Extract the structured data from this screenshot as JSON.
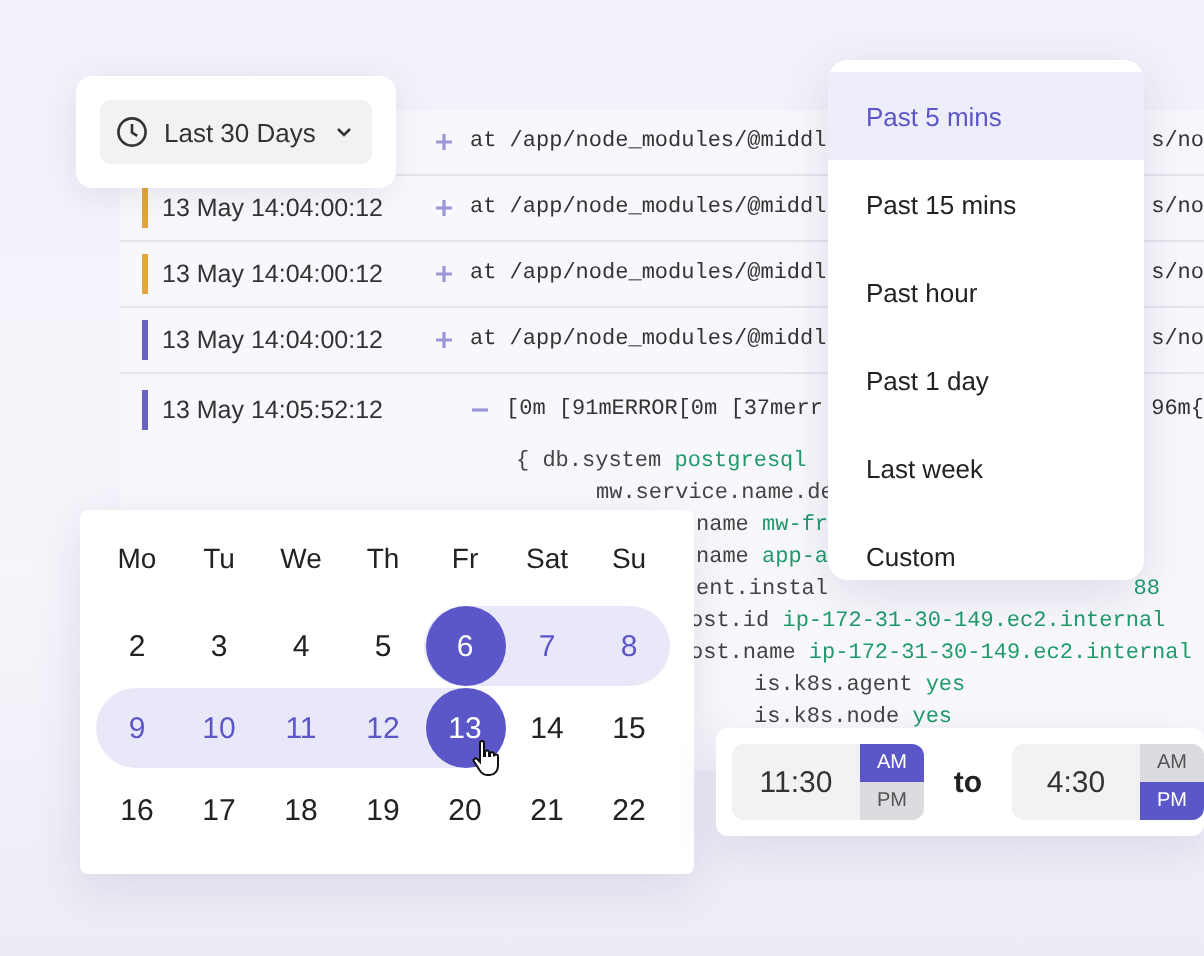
{
  "date_button": {
    "label": "Last 30 Days"
  },
  "log_rows": [
    {
      "expanded": false,
      "text": "at /app/node_modules/@middl",
      "tail": "s/no"
    },
    {
      "timestamp": "13 May 14:04:00:12",
      "color": "#e3a63a",
      "expanded": false,
      "text": "at /app/node_modules/@middl",
      "tail": "s/no"
    },
    {
      "timestamp": "13 May 14:04:00:12",
      "color": "#e3a63a",
      "expanded": false,
      "text": "at /app/node_modules/@middl",
      "tail": "s/no"
    },
    {
      "timestamp": "13 May 14:04:00:12",
      "color": "#6a62c2",
      "expanded": false,
      "text": "at /app/node_modules/@middl",
      "tail": "s/no"
    },
    {
      "timestamp": "13 May 14:05:52:12",
      "color": "#6a62c2",
      "expanded": true,
      "text": "[0m [91mERROR[0m [37merr",
      "tail": "96m{"
    }
  ],
  "code_lines": [
    {
      "key": "{ db.system",
      "value": "postgresql"
    },
    {
      "key": "mw.service.name.de"
    },
    {
      "key": "name",
      "value": "mw-fr"
    },
    {
      "key": "name",
      "value": "app-a"
    },
    {
      "key": "ent.instal",
      "tail": "88"
    },
    {
      "key": "ost.id",
      "value": "ip-172-31-30-149.ec2.internal"
    },
    {
      "key": "ost.name",
      "value": "ip-172-31-30-149.ec2.internal"
    },
    {
      "key": "is.k8s.agent",
      "value": "yes"
    },
    {
      "key": "is.k8s.node",
      "value": "yes"
    }
  ],
  "range_menu": [
    {
      "label": "Past 5 mins",
      "selected": true
    },
    {
      "label": "Past 15 mins",
      "selected": false
    },
    {
      "label": "Past hour",
      "selected": false
    },
    {
      "label": "Past 1 day",
      "selected": false
    },
    {
      "label": "Last week",
      "selected": false
    },
    {
      "label": "Custom",
      "selected": false
    }
  ],
  "calendar": {
    "weekdays": [
      "Mo",
      "Tu",
      "We",
      "Th",
      "Fr",
      "Sat",
      "Su"
    ],
    "weeks": [
      [
        {
          "label": "2",
          "selected": false,
          "in_range": false
        },
        {
          "label": "3",
          "selected": false,
          "in_range": false
        },
        {
          "label": "4",
          "selected": false,
          "in_range": false
        },
        {
          "label": "5",
          "selected": false,
          "in_range": false
        },
        {
          "label": "6",
          "selected": true,
          "in_range": true
        },
        {
          "label": "7",
          "selected": false,
          "in_range": true
        },
        {
          "label": "8",
          "selected": false,
          "in_range": true
        }
      ],
      [
        {
          "label": "9",
          "selected": false,
          "in_range": true
        },
        {
          "label": "10",
          "selected": false,
          "in_range": true
        },
        {
          "label": "11",
          "selected": false,
          "in_range": true
        },
        {
          "label": "12",
          "selected": false,
          "in_range": true
        },
        {
          "label": "13",
          "selected": true,
          "in_range": true
        },
        {
          "label": "14",
          "selected": false,
          "in_range": false
        },
        {
          "label": "15",
          "selected": false,
          "in_range": false
        }
      ],
      [
        {
          "label": "16",
          "selected": false,
          "in_range": false
        },
        {
          "label": "17",
          "selected": false,
          "in_range": false
        },
        {
          "label": "18",
          "selected": false,
          "in_range": false
        },
        {
          "label": "19",
          "selected": false,
          "in_range": false
        },
        {
          "label": "20",
          "selected": false,
          "in_range": false
        },
        {
          "label": "21",
          "selected": false,
          "in_range": false
        },
        {
          "label": "22",
          "selected": false,
          "in_range": false
        }
      ]
    ]
  },
  "time_range": {
    "separator": "to",
    "times": [
      {
        "value": "11:30",
        "periods": [
          {
            "label": "AM",
            "selected": true
          },
          {
            "label": "PM",
            "selected": false
          }
        ]
      },
      {
        "value": "4:30",
        "periods": [
          {
            "label": "AM",
            "selected": false
          },
          {
            "label": "PM",
            "selected": true
          }
        ]
      }
    ]
  }
}
